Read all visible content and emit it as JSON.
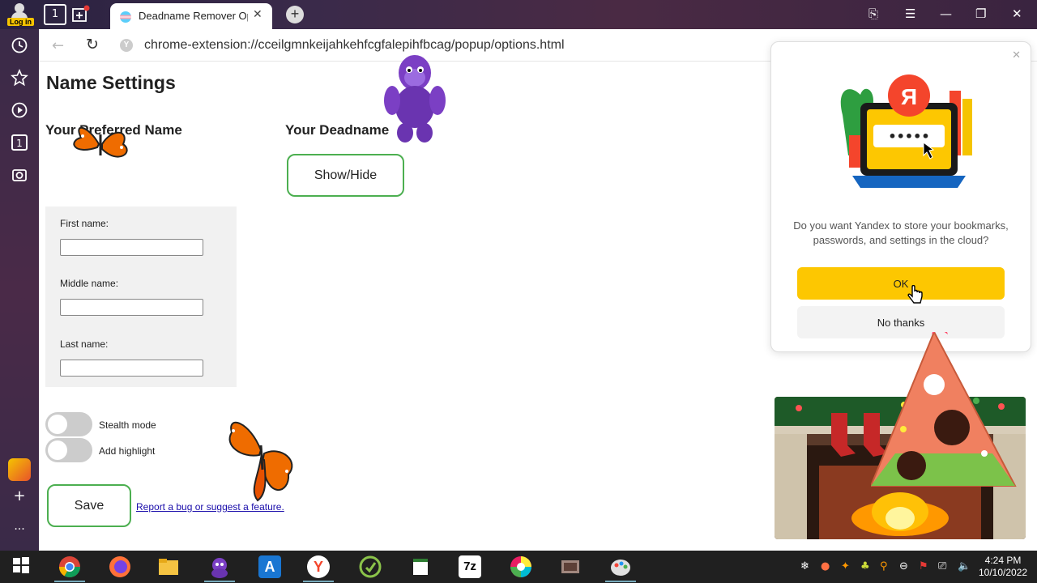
{
  "titlebar": {
    "login_label": "Log in",
    "home_badge": "1",
    "tab_title": "Deadname Remover Op",
    "tab_close": "✕",
    "new_tab": "+",
    "window_controls": {
      "bookmark": "⎘",
      "menu": "☰",
      "minimize": "—",
      "restore": "❐",
      "close": "✕"
    }
  },
  "sidebar": {
    "items": [
      {
        "name": "history",
        "glyph": "🕒"
      },
      {
        "name": "favorites",
        "glyph": "☆"
      },
      {
        "name": "media",
        "glyph": "▶"
      },
      {
        "name": "tab-counter",
        "glyph": "1"
      },
      {
        "name": "screenshot",
        "glyph": "📷"
      }
    ],
    "add_glyph": "+",
    "more_glyph": "···"
  },
  "addressbar": {
    "back": "←",
    "reload": "↻",
    "site_icon": "Y",
    "url": "chrome-extension://cceilgmnkeijahkehfcgfalepihfbcag/popup/options.html"
  },
  "page": {
    "title": "Name Settings",
    "preferred_heading": "Your Preferred Name",
    "deadname_heading": "Your Deadname",
    "show_hide_label": "Show/Hide",
    "form": {
      "first_label": "First name:",
      "first_value": "",
      "middle_label": "Middle name:",
      "middle_value": "",
      "last_label": "Last name:",
      "last_value": ""
    },
    "toggles": {
      "stealth_label": "Stealth mode",
      "stealth_on": false,
      "highlight_label": "Add highlight",
      "highlight_on": false
    },
    "save_label": "Save",
    "report_link": "Report a bug or suggest a feature."
  },
  "popup": {
    "close": "✕",
    "logo_letter": "Я",
    "password_dots": "•••••",
    "message": "Do you want Yandex to store your bookmarks, passwords, and settings in the cloud?",
    "ok_label": "OK",
    "no_thanks_label": "No thanks",
    "ok_color": "#fdc701"
  },
  "taskbar": {
    "apps": [
      {
        "name": "windows-start",
        "glyph": "⊞"
      },
      {
        "name": "chrome",
        "glyph": ""
      },
      {
        "name": "firefox",
        "glyph": ""
      },
      {
        "name": "file-explorer",
        "glyph": ""
      },
      {
        "name": "bonzi",
        "glyph": ""
      },
      {
        "name": "app-store",
        "glyph": "A"
      },
      {
        "name": "yandex",
        "glyph": "Y"
      },
      {
        "name": "green-app",
        "glyph": ""
      },
      {
        "name": "notepad",
        "glyph": ""
      },
      {
        "name": "7zip",
        "glyph": "7z"
      },
      {
        "name": "color-app",
        "glyph": ""
      },
      {
        "name": "game",
        "glyph": ""
      },
      {
        "name": "paint",
        "glyph": ""
      }
    ],
    "time": "4:24 PM",
    "date": "10/10/2022"
  }
}
